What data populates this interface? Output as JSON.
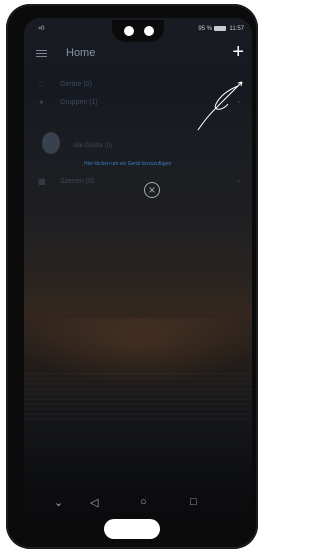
{
  "status": {
    "signal": "⁴ᴳ",
    "battery_pct": "95 %",
    "time": "11:57"
  },
  "appbar": {
    "title": "Home",
    "add_icon": "plus-icon"
  },
  "list": {
    "devices": "Geräte (0)",
    "groups": "Gruppen (1)",
    "all_devices": "Alle Geräte (0)",
    "hint": "Hier klicken um ein Gerät hinzuzufügen",
    "scenes": "Szenen (0)"
  },
  "nav": {
    "down": "⌄",
    "back": "◁",
    "home": "○",
    "recents": "□"
  },
  "colors": {
    "accent": "#3c7fc5"
  }
}
